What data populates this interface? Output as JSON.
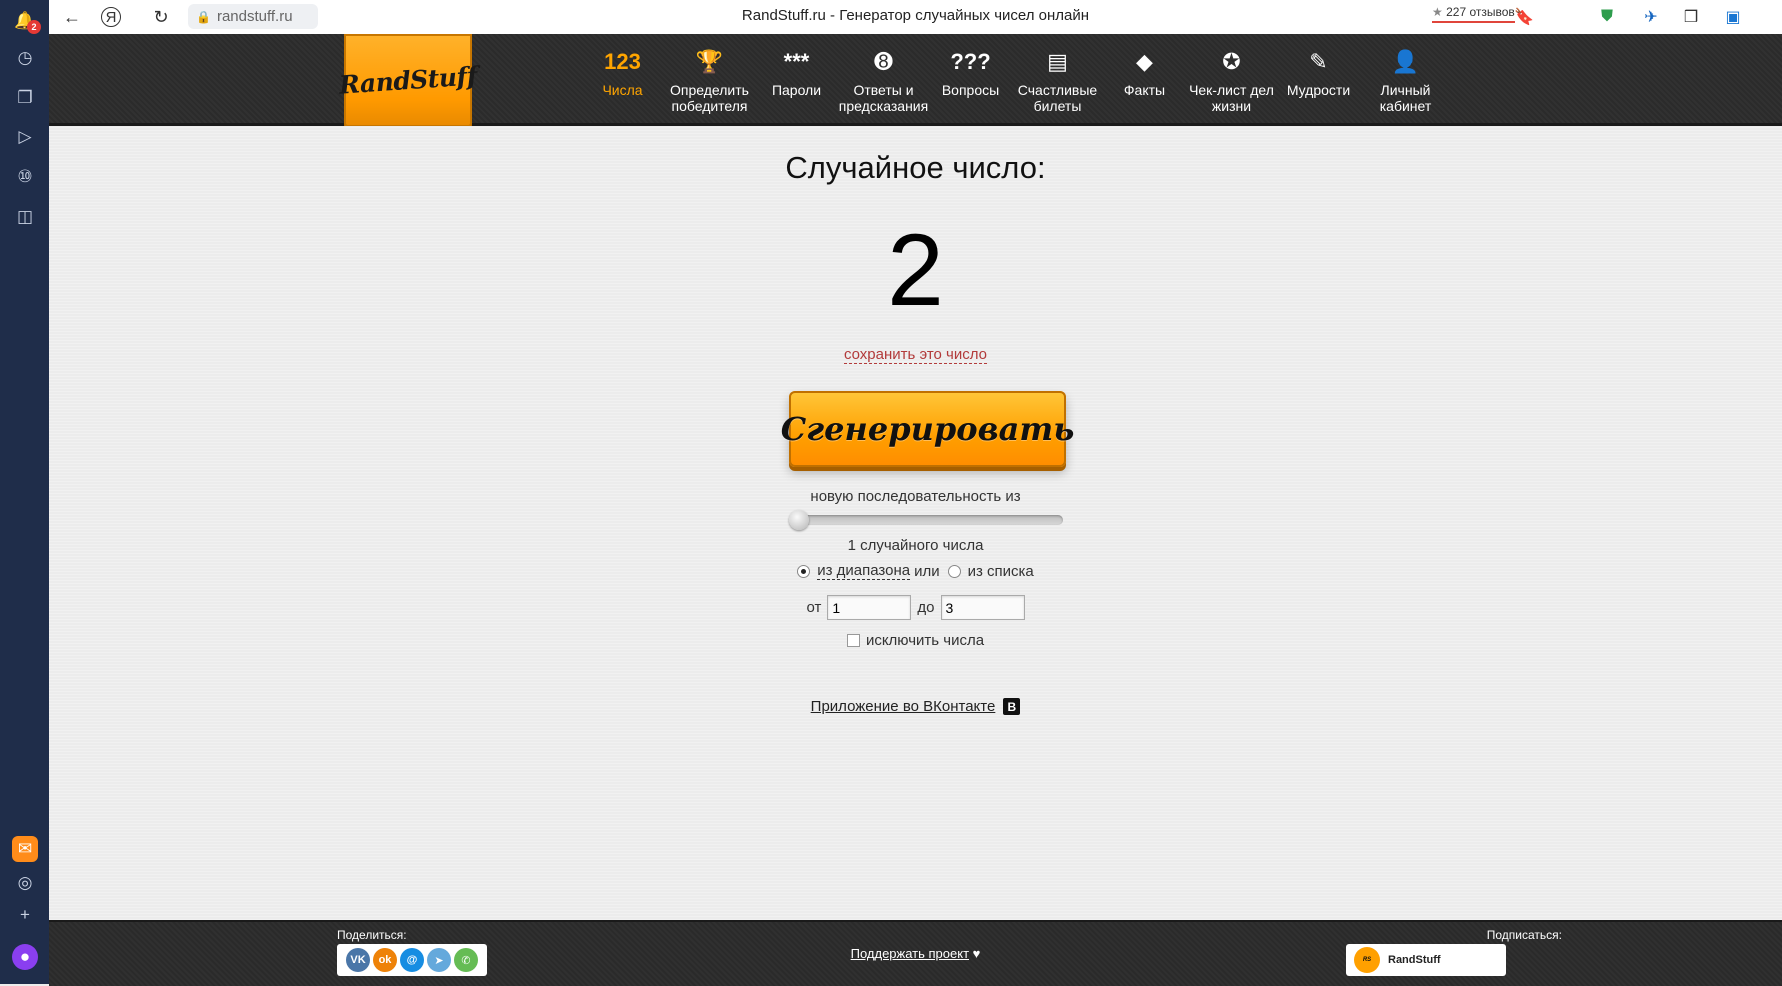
{
  "browser": {
    "url": "randstuff.ru",
    "title": "RandStuff.ru - Генератор случайных чисел онлайн",
    "reviews": "227 отзывов",
    "notification_count": "2"
  },
  "site": {
    "logo": "RandStuff",
    "nav": [
      {
        "label": "Числа",
        "icon": "123"
      },
      {
        "label": "Определить победителя",
        "icon": "trophy-icon"
      },
      {
        "label": "Пароли",
        "icon": "***"
      },
      {
        "label": "Ответы и предсказания",
        "icon": "8-ball-icon"
      },
      {
        "label": "Вопросы",
        "icon": "???"
      },
      {
        "label": "Счастливые билеты",
        "icon": "tickets-icon"
      },
      {
        "label": "Факты",
        "icon": "warning-icon"
      },
      {
        "label": "Чек-лист дел жизни",
        "icon": "badge-check-icon"
      },
      {
        "label": "Мудрости",
        "icon": "scroll-icon"
      },
      {
        "label": "Личный кабинет",
        "icon": "user-icon"
      }
    ]
  },
  "main": {
    "result_title": "Случайное число:",
    "result_value": "2",
    "save_link": "сохранить это число",
    "generate_button": "Сгенерировать",
    "sequence_text": "новую последовательность из",
    "count_text": "1 случайного числа",
    "mode_range": "из диапазона",
    "mode_or": "или",
    "mode_list": "из списка",
    "from_label": "от",
    "from_value": "1",
    "to_label": "до",
    "to_value": "3",
    "exclude_label": "исключить числа",
    "vk_app": "Приложение во ВКонтакте",
    "vk_badge": "B"
  },
  "footer": {
    "share_label": "Поделиться:",
    "support": "Поддержать проект",
    "subscribe_label": "Подписаться:",
    "subscribe_name": "RandStuff",
    "social": [
      {
        "name": "vk",
        "glyph": "VK",
        "color": "#4a76a8"
      },
      {
        "name": "ok",
        "glyph": "ok",
        "color": "#ee8208"
      },
      {
        "name": "moimir",
        "glyph": "@",
        "color": "#168de2"
      },
      {
        "name": "telegram",
        "glyph": "➤",
        "color": "#64a9dc"
      },
      {
        "name": "whatsapp",
        "glyph": "✆",
        "color": "#65bc54"
      }
    ]
  },
  "colors": {
    "accent": "#ffa500",
    "header_bg": "#2e2e2e",
    "sidebar_bg": "#1f2d4a"
  }
}
